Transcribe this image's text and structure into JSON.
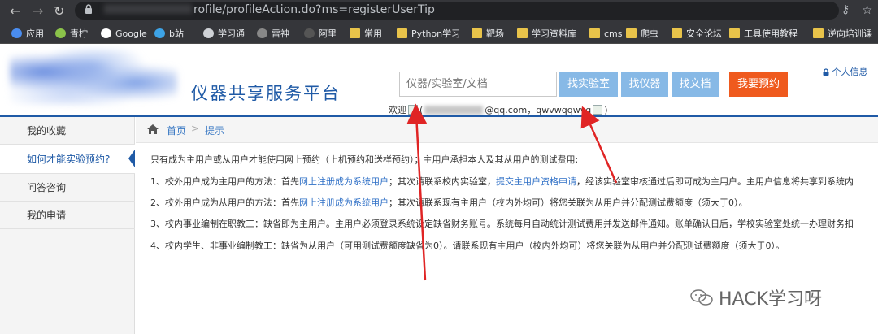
{
  "browser": {
    "url_text": "rofile/profileAction.do?ms=registerUserTip",
    "bookmarks": [
      {
        "label": "应用",
        "icon": "apps-grid-icon"
      },
      {
        "label": "青柠",
        "icon": "lime-icon"
      },
      {
        "label": "Google",
        "icon": "google-icon"
      },
      {
        "label": "b站",
        "icon": "bilibili-icon"
      },
      {
        "label": "学习通",
        "icon": "globe-icon"
      },
      {
        "label": "雷神",
        "icon": "thunder-icon"
      },
      {
        "label": "阿里",
        "icon": "ali-icon"
      },
      {
        "label": "常用",
        "icon": "folder-icon"
      },
      {
        "label": "Python学习",
        "icon": "folder-icon"
      },
      {
        "label": "靶场",
        "icon": "folder-icon"
      },
      {
        "label": "学习资料库",
        "icon": "folder-icon"
      },
      {
        "label": "cms",
        "icon": "folder-icon"
      },
      {
        "label": "爬虫",
        "icon": "folder-icon"
      },
      {
        "label": "安全论坛",
        "icon": "folder-icon"
      },
      {
        "label": "工具使用教程",
        "icon": "folder-icon"
      },
      {
        "label": "逆向培训课",
        "icon": "folder-icon"
      }
    ]
  },
  "header": {
    "site_title": "仪器共享服务平台",
    "search_placeholder": "仪器/实验室/文档",
    "btn_lab": "找实验室",
    "btn_instrument": "找仪器",
    "btn_doc": "找文档",
    "btn_reserve": "我要预约",
    "personal_info": "个人信息",
    "welcome_prefix": "欢迎",
    "welcome_open": "(",
    "welcome_email_tail": "@qq.com，qwvwqqwvq",
    "welcome_close": ")"
  },
  "sidebar": {
    "items": [
      {
        "label": "我的收藏"
      },
      {
        "label": "如何才能实验预约?"
      },
      {
        "label": "问答咨询"
      },
      {
        "label": "我的申请"
      }
    ]
  },
  "breadcrumb": {
    "home": "首页",
    "sep": ">",
    "current": "提示"
  },
  "content": {
    "intro": "只有成为主用户或从用户才能使用网上预约（上机预约和送样预约）；主用户承担本人及其从用户的测试费用:",
    "l1_a": "1、校外用户成为主用户的方法：首先",
    "l1_link1": "网上注册成为系统用户",
    "l1_b": "；其次请联系校内实验室，",
    "l1_link2": "提交主用户资格申请",
    "l1_c": "，经该实验室审核通过后即可成为主用户。主用户信息将共享到系统内",
    "l2_a": "2、校外用户成为从用户的方法：首先",
    "l2_link": "网上注册成为系统用户",
    "l2_b": "；其次请联系现有主用户（校内外均可）将您关联为从用户并分配测试费额度（须大于0）。",
    "l3": "3、校内事业编制在职教工：缺省即为主用户。主用户必须登录系统设定缺省财务账号。系统每月自动统计测试费用并发送邮件通知。账单确认日后，学校实验室处统一办理财务扣",
    "l4": "4、校内学生、非事业编制教工：缺省为从用户（可用测试费额度缺省为0）。请联系现有主用户（校内外均可）将您关联为从用户并分配测试费额度（须大于0）。"
  },
  "watermark": "HACK学习呀",
  "colors": {
    "brand_blue": "#1f5aa6",
    "search_btn": "#87b9e6",
    "reserve_btn": "#ef5a1e",
    "arrow_red": "#e02424"
  }
}
